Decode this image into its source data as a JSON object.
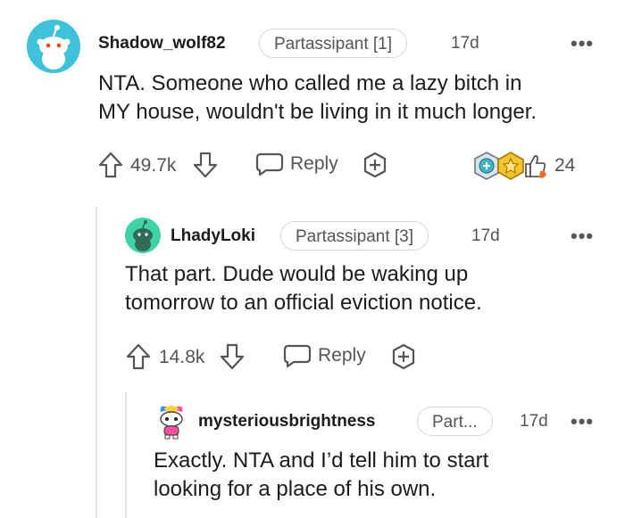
{
  "comments": [
    {
      "username": "Shadow_wolf82",
      "flair": "Partassipant [1]",
      "time": "17d",
      "body_lines": [
        "NTA. Someone who called me a lazy bitch in",
        "MY house, wouldn't be living in it much longer."
      ],
      "votes": "49.7k",
      "reply_label": "Reply",
      "award_count": "24",
      "avatar_color": "#3fc1dc"
    },
    {
      "username": "LhadyLoki",
      "flair": "Partassipant [3]",
      "time": "17d",
      "body_lines": [
        "That part. Dude would be waking up",
        "tomorrow to an official eviction notice."
      ],
      "votes": "14.8k",
      "reply_label": "Reply",
      "avatar_color": "#3fd3a8"
    },
    {
      "username": "mysteriousbrightness",
      "flair": "Part...",
      "time": "17d",
      "body_lines": [
        "Exactly. NTA and I’d tell him to start",
        "looking for a place of his own."
      ],
      "avatar_color": "#ff4fa0"
    }
  ],
  "more_label": "•••",
  "colors": {
    "muted": "#555555",
    "thread_line": "#e7e7e7",
    "flair_border": "#d6d6d6"
  }
}
